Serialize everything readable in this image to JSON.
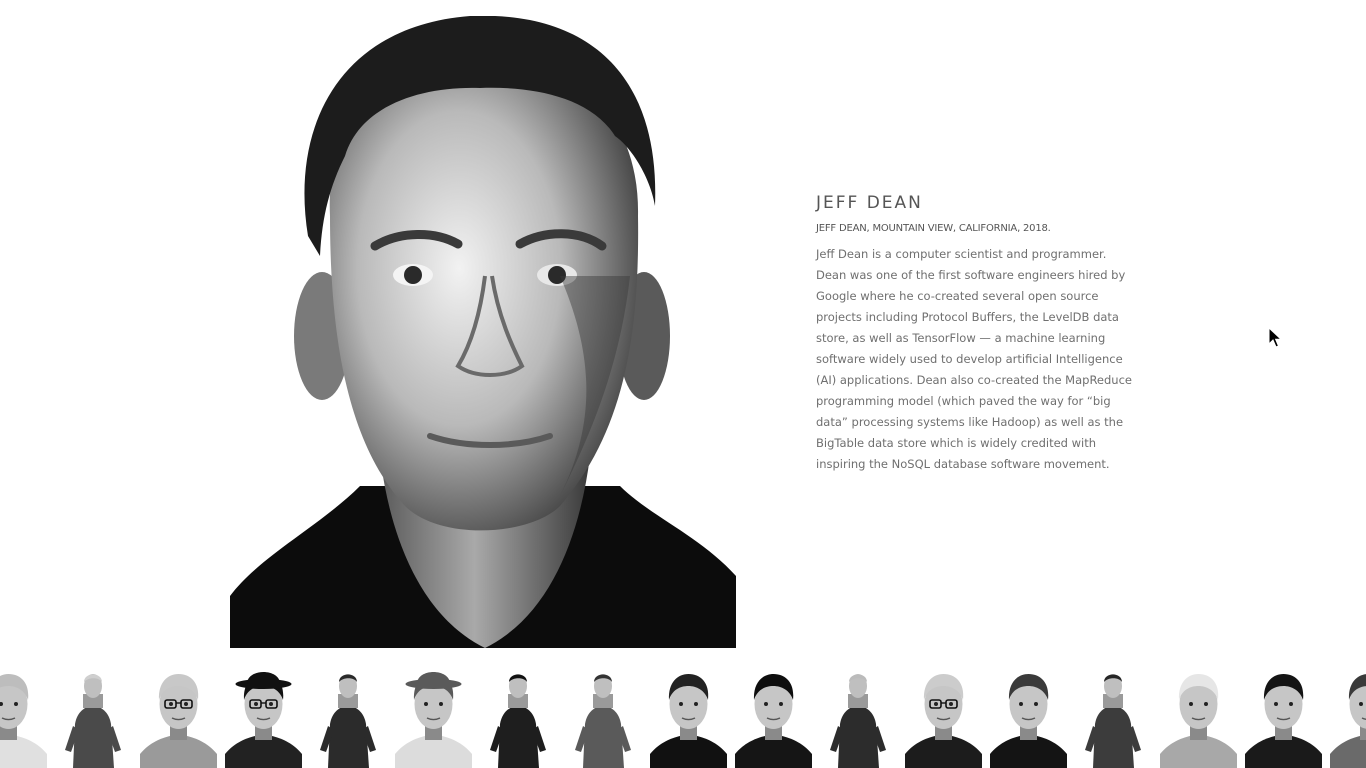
{
  "featured": {
    "name": "JEFF DEAN",
    "caption": "JEFF DEAN, MOUNTAIN VIEW, CALIFORNIA, 2018.",
    "bio": "Jeff Dean is a computer scientist and programmer. Dean was one of the first software engineers hired by Google where he co-created several open source projects including Protocol Buffers, the LevelDB data store, as well as TensorFlow — a machine learning software widely used to develop artificial Intelligence (AI) applications. Dean also co-created the MapReduce programming model (which paved the way for “big data” processing systems like Hadoop) as well as the BigTable data store which is widely credited with inspiring the NoSQL database software movement."
  },
  "thumbnails": [
    {
      "type": "headshot",
      "hair": "#bdbdbd",
      "shirt": "#e0e0e0"
    },
    {
      "type": "full",
      "hair": "#cfcfcf",
      "shirt": "#4a4a4a"
    },
    {
      "type": "headshot",
      "hair": "#c8c8c8",
      "shirt": "#9a9a9a",
      "glasses": true
    },
    {
      "type": "headshot",
      "hair": "#111111",
      "shirt": "#222222",
      "hat": true,
      "glasses": true
    },
    {
      "type": "full",
      "hair": "#2a2a2a",
      "shirt": "#2b2b2b"
    },
    {
      "type": "headshot",
      "hair": "#5a5a5a",
      "shirt": "#dcdcdc",
      "hat": true
    },
    {
      "type": "full",
      "hair": "#111111",
      "shirt": "#1e1e1e"
    },
    {
      "type": "full",
      "hair": "#333333",
      "shirt": "#5a5a5a"
    },
    {
      "type": "headshot",
      "hair": "#222222",
      "shirt": "#111111"
    },
    {
      "type": "headshot",
      "hair": "#0e0e0e",
      "shirt": "#151515"
    },
    {
      "type": "full",
      "hair": "#bbbbbb",
      "shirt": "#2c2c2c"
    },
    {
      "type": "headshot",
      "hair": "#cccccc",
      "shirt": "#1c1c1c",
      "glasses": true
    },
    {
      "type": "headshot",
      "hair": "#3a3a3a",
      "shirt": "#141414"
    },
    {
      "type": "full",
      "hair": "#262626",
      "shirt": "#3c3c3c"
    },
    {
      "type": "headshot",
      "hair": "#e6e6e6",
      "shirt": "#a8a8a8"
    },
    {
      "type": "headshot",
      "hair": "#141414",
      "shirt": "#1a1a1a"
    },
    {
      "type": "headshot",
      "hair": "#3a3a3a",
      "shirt": "#6a6a6a"
    }
  ]
}
